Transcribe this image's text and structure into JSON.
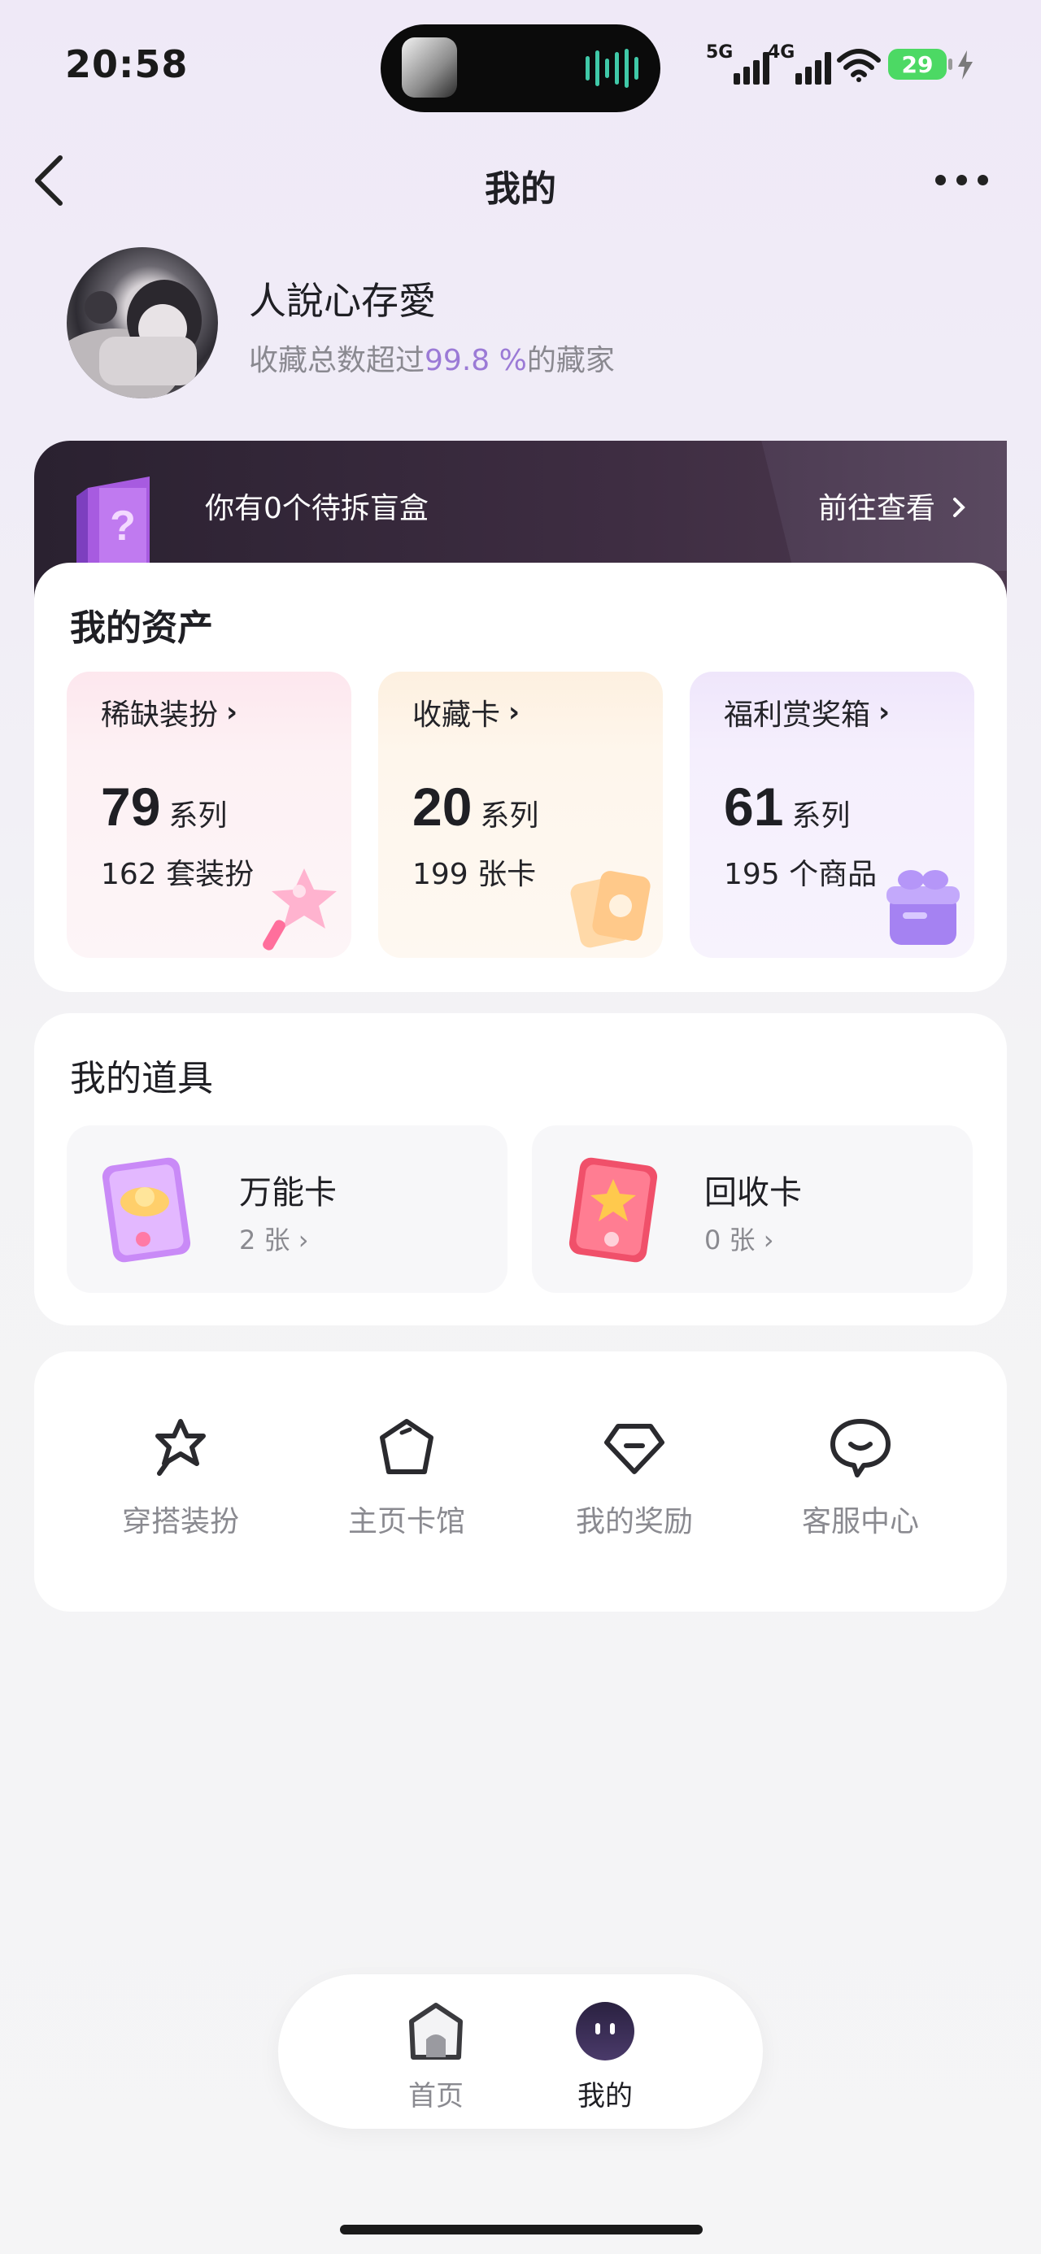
{
  "status_bar": {
    "time": "20:58",
    "signal_1": "5G",
    "signal_2": "4G",
    "battery": "29"
  },
  "nav": {
    "title": "我的",
    "back_icon": "chevron-left-icon",
    "more_icon": "more-dots-icon"
  },
  "profile": {
    "name": "人說心存愛",
    "stat_prefix": "收藏总数超过",
    "stat_value": "99.8 %",
    "stat_suffix": "的藏家"
  },
  "blind_box": {
    "text": "你有0个待拆盲盒",
    "action": "前往查看"
  },
  "assets": {
    "title": "我的资产",
    "tiles": [
      {
        "label": "稀缺装扮",
        "count": "79",
        "unit": "系列",
        "sub": "162 套装扮",
        "icon": "star-wand-icon",
        "accent": "#fde8ee"
      },
      {
        "label": "收藏卡",
        "count": "20",
        "unit": "系列",
        "sub": "199 张卡",
        "icon": "cards-icon",
        "accent": "#fdf0e2"
      },
      {
        "label": "福利赏奖箱",
        "count": "61",
        "unit": "系列",
        "sub": "195 个商品",
        "icon": "gift-box-icon",
        "accent": "#f1eafc"
      }
    ]
  },
  "tools": {
    "title": "我的道具",
    "items": [
      {
        "name": "万能卡",
        "count": "2 张",
        "icon": "universal-card-icon"
      },
      {
        "name": "回收卡",
        "count": "0 张",
        "icon": "recycle-card-icon"
      }
    ]
  },
  "menu": [
    {
      "label": "穿搭装扮",
      "icon": "outfit-star-icon"
    },
    {
      "label": "主页卡馆",
      "icon": "pentagon-icon"
    },
    {
      "label": "我的奖励",
      "icon": "diamond-icon"
    },
    {
      "label": "客服中心",
      "icon": "chat-bubble-icon"
    }
  ],
  "tabbar": [
    {
      "label": "首页",
      "icon": "home-icon",
      "active": false
    },
    {
      "label": "我的",
      "icon": "profile-face-icon",
      "active": true
    }
  ],
  "colors": {
    "accent_purple": "#9b7ad6",
    "banner_dark": "#2a2130"
  }
}
